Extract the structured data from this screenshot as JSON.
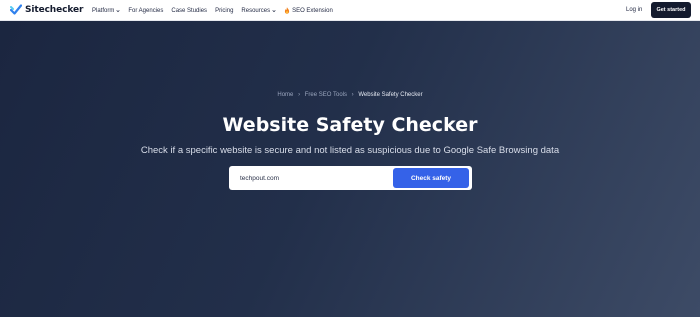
{
  "brand": {
    "name": "Sitechecker"
  },
  "nav": {
    "items": [
      {
        "label": "Platform",
        "dropdown": true
      },
      {
        "label": "For Agencies",
        "dropdown": false
      },
      {
        "label": "Case Studies",
        "dropdown": false
      },
      {
        "label": "Pricing",
        "dropdown": false
      },
      {
        "label": "Resources",
        "dropdown": true
      },
      {
        "label": "SEO Extension",
        "dropdown": false,
        "icon": "fire-icon"
      }
    ],
    "login": "Log in",
    "cta": "Get started"
  },
  "breadcrumb": {
    "home": "Home",
    "tools": "Free SEO Tools",
    "current": "Website Safety Checker"
  },
  "hero": {
    "title": "Website Safety Checker",
    "subtitle": "Check if a specific website is secure and not listed as suspicious due to Google Safe Browsing data"
  },
  "search": {
    "value": "techpout.com",
    "button": "Check safety"
  },
  "colors": {
    "brand_dark": "#141b2e",
    "hero_bg": "#1f2b45",
    "accent_blue": "#3562e8",
    "logo_blue": "#2f80ed"
  }
}
